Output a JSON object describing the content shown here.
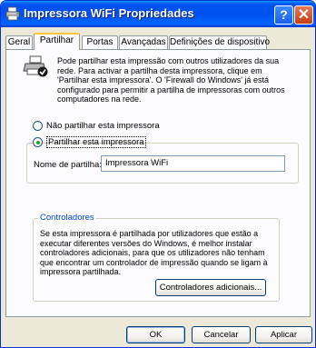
{
  "window": {
    "title": "Impressora WiFi Propriedades",
    "help_label": "?",
    "close_label": "✕"
  },
  "tabs": [
    {
      "label": "Geral",
      "active": false
    },
    {
      "label": "Partilhar",
      "active": true
    },
    {
      "label": "Portas",
      "active": false
    },
    {
      "label": "Avançadas",
      "active": false
    },
    {
      "label": "Definições de dispositivo",
      "active": false
    }
  ],
  "intro": {
    "icon": "shared-printer-icon",
    "text": "Pode partilhar esta impressão com outros utilizadores da sua rede. Para activar a partilha desta impressora, clique em 'Partilhar esta impressora'.  O 'Firewall do Windows' já está configurado para permitir a partilha de impressoras com outros computadores na rede."
  },
  "sharing": {
    "no_share_label": "Não partilhar esta impressora",
    "share_label": "Partilhar esta impressora",
    "selected": "share",
    "share_name_label": "Nome de partilha:",
    "share_name_value": "Impressora WiFi"
  },
  "drivers": {
    "title": "Controladores",
    "text": "Se esta impressora é partilhada por utilizadores que estão a executar diferentes versões do Windows, é melhor instalar controladores adicionais, para que os utilizadores não tenham que encontrar um  controlador de impressão quando se ligam à impressora partilhada.",
    "additional_button": "Controladores adicionais..."
  },
  "footer": {
    "ok": "OK",
    "cancel": "Cancelar",
    "apply": "Aplicar"
  },
  "colors": {
    "titlebar": "#0053ee",
    "accent_tab": "#ffc83c",
    "group_title": "#0046d5",
    "radio_dot": "#21a121"
  }
}
